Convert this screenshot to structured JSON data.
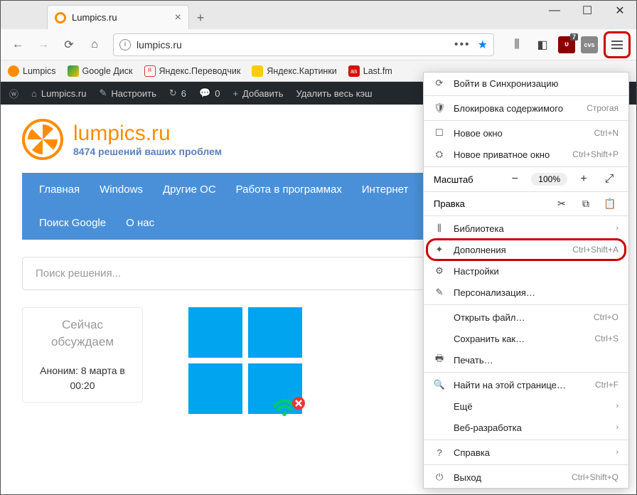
{
  "window": {
    "title": "Lumpics.ru"
  },
  "url": "lumpics.ru",
  "bookmarks": [
    {
      "label": "Lumpics",
      "color": "#ff8c00"
    },
    {
      "label": "Google Диск",
      "color": "#0f9d58"
    },
    {
      "label": "Яндекс.Переводчик",
      "color": "#d33"
    },
    {
      "label": "Яндекс.Картинки",
      "color": "#fc0"
    },
    {
      "label": "Last.fm",
      "color": "#d51007"
    }
  ],
  "wpbar": {
    "site": "Lumpics.ru",
    "customize": "Настроить",
    "updates": "6",
    "comments": "0",
    "add": "Добавить",
    "clear": "Удалить весь кэш"
  },
  "ublock_badge": "7",
  "site": {
    "title": "lumpics.ru",
    "subtitle": "8474 решений ваших проблем",
    "nav1": [
      "Главная",
      "Windows",
      "Другие ОС",
      "Работа в программах",
      "Интернет"
    ],
    "nav2": [
      "Поиск Google",
      "О нас"
    ],
    "search_placeholder": "Поиск решения...",
    "discuss_title": "Сейчас обсуждаем",
    "discuss_meta": "Аноним: 8 марта в 00:20"
  },
  "menu": {
    "sync": "Войти в Синхронизацию",
    "block": "Блокировка содержимого",
    "block_level": "Строгая",
    "new_win": "Новое окно",
    "new_win_s": "Ctrl+N",
    "new_priv": "Новое приватное окно",
    "new_priv_s": "Ctrl+Shift+P",
    "zoom": "Масштаб",
    "zoom_val": "100%",
    "edit": "Правка",
    "library": "Библиотека",
    "addons": "Дополнения",
    "addons_s": "Ctrl+Shift+A",
    "settings": "Настройки",
    "personalize": "Персонализация…",
    "open_file": "Открыть файл…",
    "open_file_s": "Ctrl+O",
    "save_as": "Сохранить как…",
    "save_as_s": "Ctrl+S",
    "print": "Печать…",
    "find": "Найти на этой странице…",
    "find_s": "Ctrl+F",
    "more": "Ещё",
    "webdev": "Веб-разработка",
    "help": "Справка",
    "exit": "Выход",
    "exit_s": "Ctrl+Shift+Q"
  }
}
